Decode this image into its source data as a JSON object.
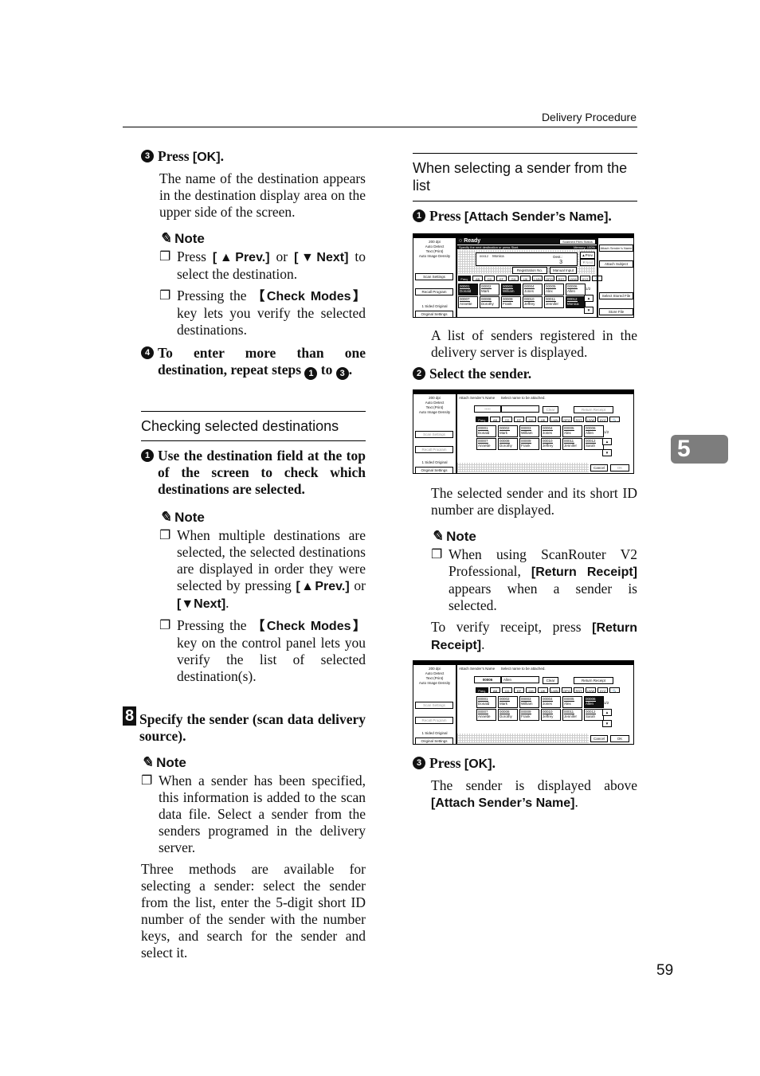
{
  "header": {
    "title": "Delivery Procedure"
  },
  "chapter_tab": "5",
  "page_number": "59",
  "left": {
    "step3": {
      "num": "3",
      "title_prefix": "Press ",
      "title_key": "[OK]",
      "title_suffix": ".",
      "body": "The name of the destination appears in the destination display area on the upper side of the screen."
    },
    "note1": {
      "label": "Note",
      "b1": {
        "a": "Press ",
        "k1": "[▲Prev.]",
        "b": " or ",
        "k2": "[▼Next]",
        "c": " to select the destination."
      },
      "b2": {
        "a": "Pressing the ",
        "k1": "【Check Modes】",
        "b": " key lets you verify the selected destinations."
      }
    },
    "step4": {
      "num": "4",
      "text_a": "To enter more than one destination, repeat steps ",
      "n1": "1",
      "mid": " to ",
      "n2": "3",
      "end": "."
    },
    "section_title": "Checking selected destinations",
    "step1": {
      "num": "1",
      "text": "Use the destination field at the top of the screen to check which destinations are selected."
    },
    "note2": {
      "label": "Note",
      "b1": {
        "a": "When multiple destinations are selected, the selected destinations are displayed in order they were selected by pressing ",
        "k1": "[▲Prev.]",
        "b": " or ",
        "k2": "[▼Next]",
        "c": "."
      },
      "b2": {
        "a": "Pressing the ",
        "k1": "【Check Modes】",
        "b": " key on the control panel lets you verify the list of selected destination(s)."
      }
    },
    "step8": {
      "num": "8",
      "text": "Specify the sender (scan data delivery source)."
    },
    "note3": {
      "label": "Note",
      "b1": "When a sender has been specified, this information is added to the scan data file. Select a sender from the senders programed in the delivery server."
    },
    "methods": "Three methods are available for selecting a sender: select the sender from the list, enter the 5-digit short ID number of the sender with the number keys, and search for the sender and select it."
  },
  "right": {
    "section_title": "When selecting a sender from the list",
    "step1": {
      "num": "1",
      "prefix": "Press ",
      "key": "[Attach Sender’s Name]",
      "suffix": "."
    },
    "step1_body": "A list of senders registered in the delivery server is displayed.",
    "step2": {
      "num": "2",
      "text": "Select the sender."
    },
    "step2_body": "The selected sender and its short ID number are displayed.",
    "note": {
      "label": "Note",
      "a": "When using ScanRouter V2 Professional, ",
      "k": "[Return Receipt]",
      "b": " appears when a sender is selected."
    },
    "verify": {
      "a": "To verify receipt, press ",
      "k": "[Return Receipt]",
      "b": "."
    },
    "step3": {
      "num": "3",
      "prefix": "Press ",
      "key": "[OK]",
      "suffix": "."
    },
    "step3_body": {
      "a": "The sender is displayed above ",
      "k": "[Attach Sender’s Name]",
      "b": "."
    }
  },
  "panel_common": {
    "side_info": [
      "200 dpi",
      "Auto Detect",
      "Text (Print)",
      "Auto Image Density"
    ],
    "scan_settings": "Scan Settings",
    "recall_program": "Recall Program",
    "select_original": "1 Sided Original",
    "original_settings": "Original Settings",
    "tabs": [
      "Freq.",
      "AB",
      "CD",
      "EF",
      "GH",
      "IJK",
      "LMN",
      "OPQ",
      "RST",
      "UVW",
      "XYZ"
    ],
    "page": "1/2",
    "names_row1": [
      {
        "id": "00001",
        "name": "Donald"
      },
      {
        "id": "00002",
        "name": "Mark"
      },
      {
        "id": "00003",
        "name": "William"
      },
      {
        "id": "00004",
        "name": "Jones"
      },
      {
        "id": "00005",
        "name": "Alex"
      },
      {
        "id": "00006",
        "name": "Allen"
      }
    ],
    "names_row2": [
      {
        "id": "00007",
        "name": "Annette"
      },
      {
        "id": "00008",
        "name": "Dorothy"
      },
      {
        "id": "00009",
        "name": "Frank"
      },
      {
        "id": "00010",
        "name": "Jeffrey"
      },
      {
        "id": "00011",
        "name": "Jennifer"
      },
      {
        "id": "00012",
        "name": "Sarah"
      }
    ]
  },
  "panel1": {
    "status": "Ready",
    "instruction": "Specify the next destination or press Start.",
    "scanned_files_status": "Scanned Files Status",
    "memory": "Memory: 100%",
    "dest_label": "Dest.:",
    "dest_count": "3",
    "dest_id": "00012",
    "dest_name": "Monica",
    "prev": "▲Prev.",
    "next": "▼Next",
    "registration_no": "Registration No.",
    "manual_input": "Manual Input",
    "attach_sender": "Attach Sender’s Name",
    "attach_subject": "Attach Subject",
    "select_stored_file": "Select Stored File",
    "store_file": "Store File",
    "row2_last": {
      "id": "00012",
      "name": "Monica"
    }
  },
  "panel2": {
    "title": "Attach Sender’s Name",
    "instruction": "Select name to be attached.",
    "id_value": "-----",
    "name_value": "",
    "clear": "Clear",
    "return_receipt": "Return Receipt",
    "cancel": "Cancel",
    "ok": "OK"
  },
  "panel3": {
    "title": "Attach Sender’s Name",
    "instruction": "Select name to be attached.",
    "id_value": "00006",
    "name_value": "Allen",
    "clear": "Clear",
    "return_receipt": "Return Receipt",
    "cancel": "Cancel",
    "ok": "OK"
  }
}
